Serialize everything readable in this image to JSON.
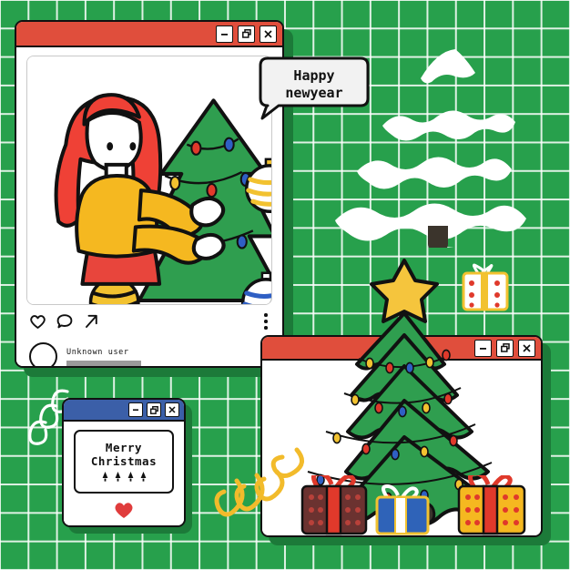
{
  "theme": {
    "bg_green": "#27a04c",
    "grid_line": "#ffffff",
    "shadow_green": "#1c7a39",
    "titlebar_red": "#e04e3c",
    "titlebar_blue": "#3b5fa8",
    "outline": "#111111",
    "tree_green": "#2f9e4f",
    "star_yellow": "#f5c53d",
    "hair_red": "#ef4136",
    "sweater_yellow": "#f5b820",
    "skirt_red": "#e8453c",
    "heart_red": "#e03c3c",
    "squiggle_yellow": "#f2bb2b",
    "snow_white": "#ffffff"
  },
  "window_controls": {
    "minimize": "minimize",
    "restore": "restore",
    "close": "close"
  },
  "post_window": {
    "title": "",
    "speech_bubble": {
      "line1": "Happy",
      "line2": "newyear"
    },
    "illustration": {
      "name": "woman-decorating-christmas-tree",
      "character": "woman with red hair, yellow sweater, red skirt",
      "tree": "green christmas tree with baubles and lights"
    },
    "actions": [
      {
        "name": "like",
        "icon": "heart-icon"
      },
      {
        "name": "comment",
        "icon": "comment-icon"
      },
      {
        "name": "share",
        "icon": "share-icon"
      }
    ],
    "more_menu_icon": "three-dots-icon",
    "user": {
      "name": "Unknown  user",
      "avatar": "avatar-placeholder",
      "caption_placeholder": ""
    }
  },
  "merry_window": {
    "line1": "Merry",
    "line2": "Christmas",
    "glyph_count": 4,
    "heart_icon": "heart-icon"
  },
  "tree_window": {
    "title": "",
    "tree": {
      "star": "star-topper",
      "tiers": 5,
      "light_colors": [
        "#f2c230",
        "#e0392b",
        "#2f5fc4"
      ]
    },
    "gifts": [
      {
        "name": "gift-dark-red-dots",
        "box": "#6b3230",
        "ribbon": "#e0392b",
        "dots": "#b8413a"
      },
      {
        "name": "gift-blue",
        "box": "#2f63b8",
        "ribbon": "#ffffff",
        "trim": "#f2c230"
      },
      {
        "name": "gift-yellow-dots",
        "box": "#f5b820",
        "ribbon": "#e0392b",
        "dots": "#e0392b"
      }
    ]
  },
  "decor": {
    "snow_tree": "snow-covered-tree",
    "small_gift": {
      "name": "gift-white-red-dots",
      "box": "#ffffff",
      "ribbon": "#f2c230",
      "dots": "#e0392b"
    },
    "white_spiral": "white-spiral-squiggle",
    "yellow_squiggle": "yellow-loop-squiggle"
  }
}
